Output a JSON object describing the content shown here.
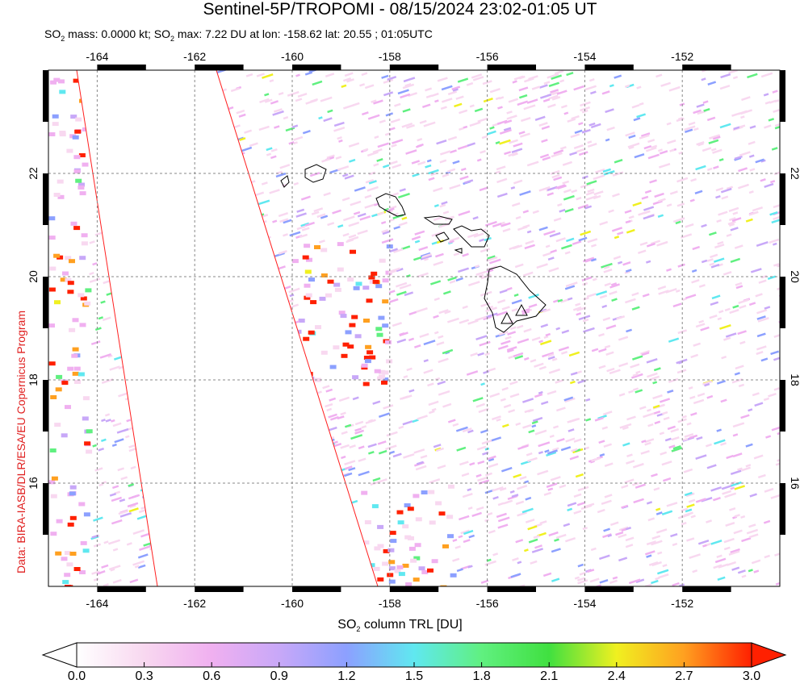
{
  "header": {
    "title": "Sentinel-5P/TROPOMI - 08/15/2024 23:02-01:05 UT",
    "stats_prefix": "SO",
    "stats_sub1": "2",
    "stats_mid": " mass: 0.0000 kt; SO",
    "stats_sub2": "2",
    "stats_suffix": " max: 7.22 DU at lon: -158.62 lat: 20.55 ; 01:05UTC"
  },
  "credit": "Data: BIRA-IASB/DLR/ESA/EU Copernicus Program",
  "map": {
    "lon_ticks": [
      "-164",
      "-162",
      "-160",
      "-158",
      "-156",
      "-154",
      "-152"
    ],
    "lat_ticks": [
      "16",
      "18",
      "20",
      "22"
    ],
    "lon_range": [
      -165,
      -150
    ],
    "lat_range": [
      14,
      24
    ],
    "volcano_marker": "triangle-icon"
  },
  "colorbar": {
    "label_prefix": "SO",
    "label_sub": "2",
    "label_suffix": " column TRL [DU]",
    "ticks": [
      "0.0",
      "0.3",
      "0.6",
      "0.9",
      "1.2",
      "1.5",
      "1.8",
      "2.1",
      "2.4",
      "2.7",
      "3.0"
    ],
    "colors": [
      "#ffffff",
      "#f8d8f0",
      "#f0b0f0",
      "#c8a8f8",
      "#8ca0ff",
      "#60e8f0",
      "#60f080",
      "#40e040",
      "#f0f020",
      "#ffa020",
      "#ff2000"
    ]
  }
}
